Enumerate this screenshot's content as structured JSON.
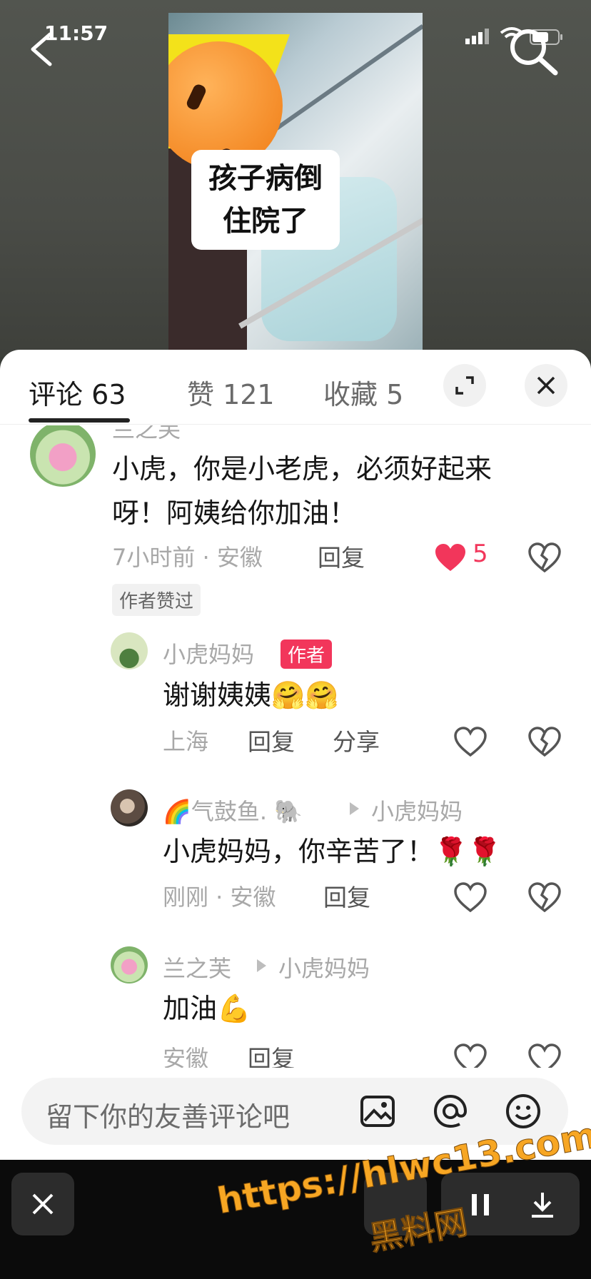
{
  "status": {
    "time": "11:57"
  },
  "video": {
    "caption_line1": "孩子病倒",
    "caption_line2": "住院了"
  },
  "tabs": [
    {
      "label": "评论 63"
    },
    {
      "label": "赞 121"
    },
    {
      "label": "收藏 5"
    }
  ],
  "comments": {
    "c1": {
      "username": "兰之芙",
      "text_line1": "小虎，你是小老虎，必须好起来",
      "text_line2": "呀！阿姨给你加油！",
      "meta": "7小时前 · 安徽",
      "reply": "回复",
      "likes": "5",
      "tag": "作者赞过"
    },
    "r1": {
      "username": "小虎妈妈",
      "badge": "作者",
      "text": "谢谢姨姨🤗🤗",
      "meta": "上海",
      "reply": "回复",
      "share": "分享"
    },
    "r2": {
      "username": "🌈气鼓鱼. 🐘",
      "reply_to": "小虎妈妈",
      "text": "小虎妈妈，你辛苦了！🌹🌹",
      "meta": "刚刚 · 安徽",
      "reply": "回复"
    },
    "r3": {
      "username": "兰之芙",
      "reply_to": "小虎妈妈",
      "text": "加油💪",
      "meta": "安徽",
      "reply": "回复"
    }
  },
  "input": {
    "placeholder": "留下你的友善评论吧"
  },
  "watermark": {
    "url": "https://hlwc13.com",
    "name": "黑料网"
  },
  "colors": {
    "like_red": "#f2365b",
    "author_badge": "#f2365b",
    "watermark": "#f7a623"
  }
}
